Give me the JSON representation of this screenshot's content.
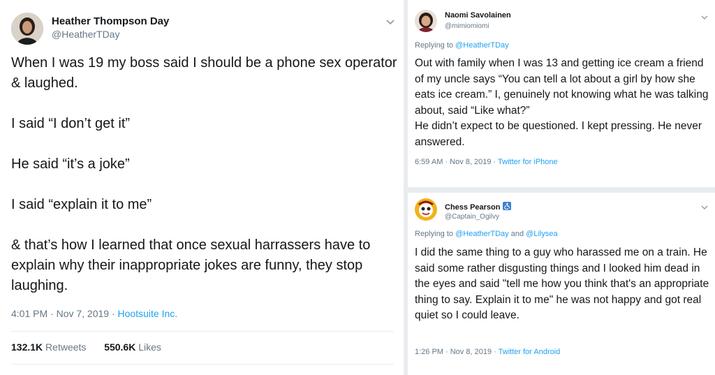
{
  "tweet_main": {
    "name": "Heather Thompson Day",
    "handle": "@HeatherTDay",
    "paragraphs": [
      "When I was 19 my boss said I should be a phone sex operator & laughed.",
      "I said “I don’t get it”",
      "He said “it’s a joke”",
      "I said “explain it to me”",
      "& that’s how I learned that once sexual harrassers have to explain why their inappropriate jokes are funny, they stop laughing."
    ],
    "time": "4:01 PM · Nov 7, 2019 · ",
    "source": "Hootsuite Inc.",
    "retweets_count": "132.1K",
    "retweets_label": "Retweets",
    "likes_count": "550.6K",
    "likes_label": "Likes"
  },
  "tweet_reply1": {
    "name": "Naomi Savolainen",
    "handle": "@mimiomiomi",
    "replying_prefix": "Replying to ",
    "replying_to": "@HeatherTDay",
    "paragraphs": [
      "Out with family when I was 13 and getting ice cream a friend of my uncle says “You can tell a lot about a girl by how she eats ice cream.” I, genuinely not knowing what he was talking about, said “Like what?”",
      "He didn’t expect to be questioned. I kept pressing. He never answered."
    ],
    "time": "6:59 AM · Nov 8, 2019 · ",
    "source": "Twitter for iPhone"
  },
  "tweet_reply2": {
    "name": "Chess Pearson",
    "handle": "@Captain_Ogilvy",
    "replying_prefix": "Replying to ",
    "replying_to_1": "@HeatherTDay",
    "replying_and": " and ",
    "replying_to_2": "@Lilysea",
    "paragraphs": [
      "I did the same thing to a guy who harassed me on a train. He said some rather disgusting things and I looked him dead in the eyes and said \"tell me how you think that's an appropriate thing to say. Explain it to me\" he was not happy and got real quiet so I could leave."
    ],
    "time": "1:26 PM · Nov 8, 2019 · ",
    "source": "Twitter for Android",
    "badge_icon": "accessibility-icon"
  },
  "colors": {
    "link": "#1da1f2",
    "muted": "#657786",
    "text": "#14171a",
    "separator": "#e9ecef"
  }
}
